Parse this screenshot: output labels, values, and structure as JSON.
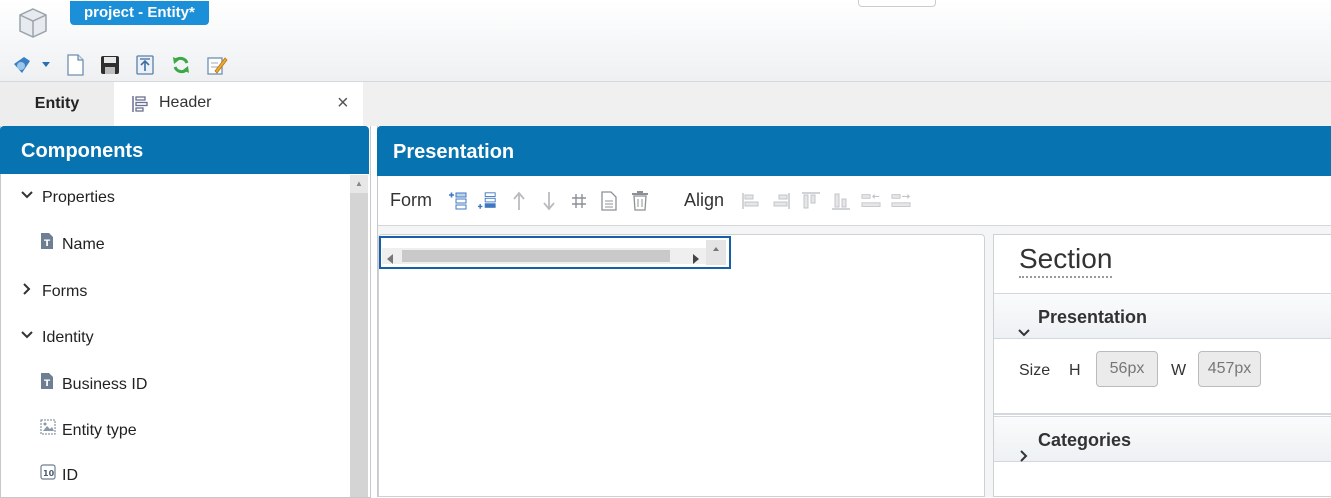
{
  "app": {
    "title": "project - Entity*",
    "toolbar_icons": [
      "dropdown-app-icon",
      "new-file-icon",
      "save-icon",
      "import-icon",
      "refresh-icon",
      "edit-icon"
    ]
  },
  "tabs": {
    "entity": "Entity",
    "header": "Header",
    "close_symbol": "×"
  },
  "components": {
    "title": "Components",
    "tree": [
      {
        "label": "Properties",
        "icon": "chevron-down-icon"
      },
      {
        "label": "Name",
        "icon": "text-field-icon"
      },
      {
        "label": "Forms",
        "icon": "chevron-right-icon"
      },
      {
        "label": "Identity",
        "icon": "chevron-down-icon"
      },
      {
        "label": "Business ID",
        "icon": "text-field-icon"
      },
      {
        "label": "Entity type",
        "icon": "image-field-icon"
      },
      {
        "label": "ID",
        "icon": "number-field-icon"
      }
    ]
  },
  "presentation": {
    "title": "Presentation",
    "form_label": "Form",
    "align_label": "Align"
  },
  "section": {
    "title": "Section",
    "presentation_header": "Presentation",
    "size_label": "Size",
    "h_label": "H",
    "w_label": "W",
    "h_value": "56px",
    "w_value": "457px",
    "categories_header": "Categories"
  },
  "colors": {
    "header_blue": "#0873b1",
    "title_tab_blue": "#1c8fd9"
  }
}
